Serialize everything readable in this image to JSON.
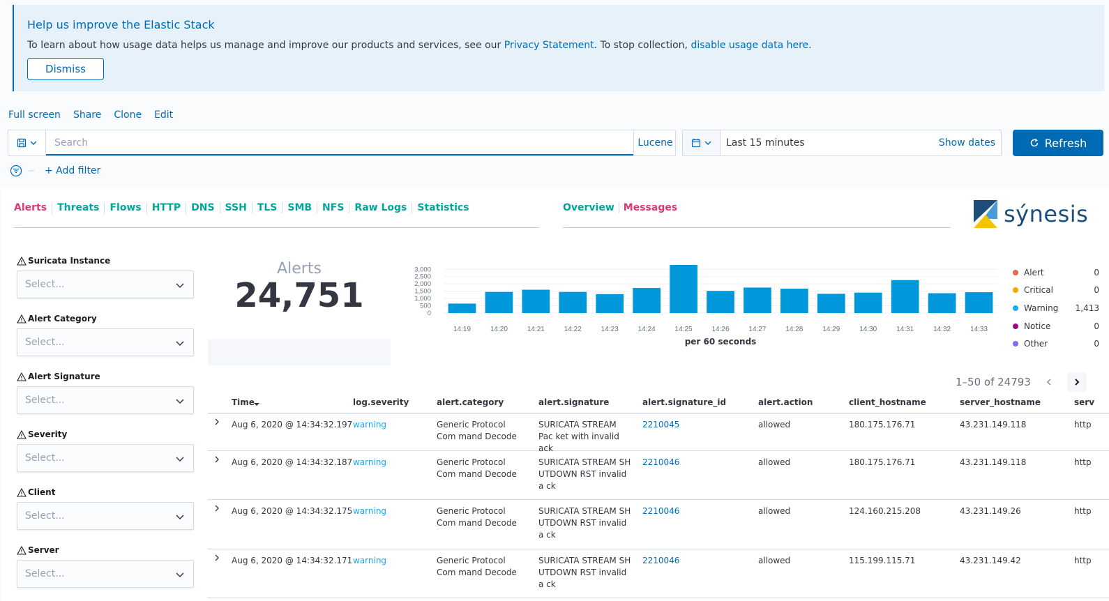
{
  "callout": {
    "title": "Help us improve the Elastic Stack",
    "body_prefix": "To learn about how usage data helps us manage and improve our products and services, see our ",
    "privacy_link": "Privacy Statement",
    "body_middle": ". To stop collection, ",
    "disable_link": "disable usage data here",
    "body_suffix": ".",
    "dismiss_label": "Dismiss"
  },
  "topnav": {
    "fullscreen": "Full screen",
    "share": "Share",
    "clone": "Clone",
    "edit": "Edit"
  },
  "querybar": {
    "placeholder": "Search",
    "language": "Lucene"
  },
  "datepicker": {
    "range": "Last 15 minutes",
    "show_dates": "Show dates",
    "refresh": "Refresh"
  },
  "filters": {
    "add_filter": "+ Add filter"
  },
  "nav": {
    "left": [
      "Alerts",
      "Threats",
      "Flows",
      "HTTP",
      "DNS",
      "SSH",
      "TLS",
      "SMB",
      "NFS",
      "Raw Logs",
      "Statistics"
    ],
    "left_active": "Alerts",
    "right": [
      "Overview",
      "Messages"
    ],
    "right_active": "Messages"
  },
  "logo": {
    "text": "sýnesis"
  },
  "controls": [
    {
      "label": "Suricata Instance",
      "placeholder": "Select..."
    },
    {
      "label": "Alert Category",
      "placeholder": "Select..."
    },
    {
      "label": "Alert Signature",
      "placeholder": "Select..."
    },
    {
      "label": "Severity",
      "placeholder": "Select..."
    },
    {
      "label": "Client",
      "placeholder": "Select..."
    },
    {
      "label": "Server",
      "placeholder": "Select..."
    }
  ],
  "metric": {
    "label": "Alerts",
    "value": "24,751"
  },
  "chart_data": {
    "type": "bar",
    "categories": [
      "14:19",
      "14:20",
      "14:21",
      "14:22",
      "14:23",
      "14:24",
      "14:25",
      "14:26",
      "14:27",
      "14:28",
      "14:29",
      "14:30",
      "14:31",
      "14:32",
      "14:33"
    ],
    "values": [
      650,
      1450,
      1600,
      1450,
      1300,
      1720,
      3300,
      1520,
      1750,
      1670,
      1320,
      1400,
      2260,
      1360,
      1430
    ],
    "xlabel": "per 60 seconds",
    "ylabel": "",
    "yticks": [
      "3,000",
      "2,500",
      "2,000",
      "1,500",
      "1,000",
      "500",
      "0"
    ],
    "ylim": [
      0,
      3300
    ],
    "grid": true,
    "color": "#0098da"
  },
  "legend": [
    {
      "name": "Alert",
      "value": "0",
      "color": "#e7664c"
    },
    {
      "name": "Critical",
      "value": "0",
      "color": "#f5a700"
    },
    {
      "name": "Warning",
      "value": "1,413",
      "color": "#1ba9f5"
    },
    {
      "name": "Notice",
      "value": "0",
      "color": "#9c0a8f"
    },
    {
      "name": "Other",
      "value": "0",
      "color": "#7e6ef5"
    }
  ],
  "pager": {
    "text": "1–50 of 24793"
  },
  "table": {
    "columns": [
      "Time",
      "log.severity",
      "alert.category",
      "alert.signature",
      "alert.signature_id",
      "alert.action",
      "client_hostname",
      "server_hostname",
      "serv"
    ],
    "rows": [
      {
        "time": "Aug 6, 2020 @ 14:34:32.197",
        "severity": "warning",
        "category": "Generic Protocol Com mand Decode",
        "signature": "SURICATA STREAM Pac ket with invalid ack",
        "sid": "2210045",
        "action": "allowed",
        "client": "180.175.176.71",
        "server": "43.231.149.118",
        "serv": "http"
      },
      {
        "time": "Aug 6, 2020 @ 14:34:32.187",
        "severity": "warning",
        "category": "Generic Protocol Com mand Decode",
        "signature": "SURICATA STREAM SH UTDOWN RST invalid a ck",
        "sid": "2210046",
        "action": "allowed",
        "client": "180.175.176.71",
        "server": "43.231.149.118",
        "serv": "http"
      },
      {
        "time": "Aug 6, 2020 @ 14:34:32.175",
        "severity": "warning",
        "category": "Generic Protocol Com mand Decode",
        "signature": "SURICATA STREAM SH UTDOWN RST invalid a ck",
        "sid": "2210046",
        "action": "allowed",
        "client": "124.160.215.208",
        "server": "43.231.149.26",
        "serv": "http"
      },
      {
        "time": "Aug 6, 2020 @ 14:34:32.171",
        "severity": "warning",
        "category": "Generic Protocol Com mand Decode",
        "signature": "SURICATA STREAM SH UTDOWN RST invalid a ck",
        "sid": "2210046",
        "action": "allowed",
        "client": "115.199.115.71",
        "server": "43.231.149.42",
        "serv": "http"
      }
    ]
  }
}
